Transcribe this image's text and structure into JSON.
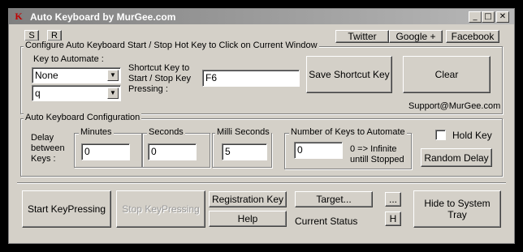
{
  "window": {
    "title": "Auto Keyboard by MurGee.com",
    "icon_letter": "K",
    "minimize_glyph": "_",
    "maximize_glyph": "□",
    "close_glyph": "✕"
  },
  "toolbar": {
    "s_label": "S",
    "r_label": "R",
    "twitter_label": "Twitter",
    "google_label": "Google +",
    "facebook_label": "Facebook"
  },
  "hotkey_group": {
    "legend": "Configure Auto Keyboard Start / Stop Hot Key to Click on Current Window",
    "key_to_automate_label": "Key to Automate :",
    "modifier_value": "None",
    "key_value": "q",
    "shortcut_label_line1": "Shortcut Key to",
    "shortcut_label_line2": "Start / Stop Key",
    "shortcut_label_line3": "Pressing :",
    "shortcut_value": "F6",
    "save_shortcut_label": "Save Shortcut Key",
    "clear_label": "Clear",
    "support_email": "Support@MurGee.com"
  },
  "config_group": {
    "legend": "Auto Keyboard Configuration",
    "delay_label_line1": "Delay",
    "delay_label_line2": "between",
    "delay_label_line3": "Keys :",
    "minutes_label": "Minutes",
    "minutes_value": "0",
    "seconds_label": "Seconds",
    "seconds_value": "0",
    "millis_label": "Milli Seconds",
    "millis_value": "5",
    "num_keys_legend": "Number of Keys to Automate",
    "num_keys_value": "0",
    "infinite_note_line1": "0 => Infinite",
    "infinite_note_line2": "untill Stopped",
    "hold_key_label": "Hold Key",
    "random_delay_label": "Random Delay"
  },
  "actions": {
    "start_label": "Start KeyPressing",
    "stop_label": "Stop KeyPressing",
    "registration_label": "Registration Key",
    "help_label": "Help",
    "target_label": "Target...",
    "current_status_label": "Current Status",
    "more_label": "...",
    "h_label": "H",
    "hide_tray_label": "Hide to System Tray"
  }
}
